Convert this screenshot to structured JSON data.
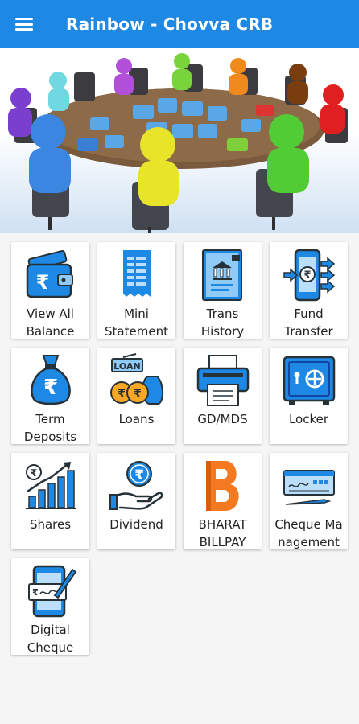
{
  "app": {
    "title": "Rainbow - Chovva CRB"
  },
  "header": {
    "menu_icon": "hamburger-menu-icon"
  },
  "banner": {
    "image": "team-puzzle-meeting-illustration"
  },
  "tiles": [
    {
      "label": "View All\nBalance",
      "icon": "wallet-rupee-icon"
    },
    {
      "label": "Mini\nStatement",
      "icon": "statement-receipt-icon"
    },
    {
      "label": "Trans\nHistory",
      "icon": "bank-document-icon"
    },
    {
      "label": "Fund\nTransfer",
      "icon": "phone-transfer-icon"
    },
    {
      "label": "Term\nDeposits",
      "icon": "money-bag-icon"
    },
    {
      "label": "Loans",
      "icon": "loan-coins-icon"
    },
    {
      "label": "GD/MDS",
      "icon": "printer-icon"
    },
    {
      "label": "Locker",
      "icon": "safe-locker-icon"
    },
    {
      "label": "Shares",
      "icon": "growth-chart-icon"
    },
    {
      "label": "Dividend",
      "icon": "hand-coin-icon"
    },
    {
      "label": "BHARAT\nBILLPAY",
      "icon": "bharat-billpay-logo-icon"
    },
    {
      "label": "Cheque Ma\nnagement",
      "icon": "cheque-pen-icon"
    },
    {
      "label": "Digital\nCheque",
      "icon": "digital-cheque-phone-icon"
    }
  ],
  "colors": {
    "appbar": "#1e88e5",
    "icon_blue": "#1e88e5",
    "icon_dark": "#263238",
    "billpay_orange": "#f47920"
  }
}
